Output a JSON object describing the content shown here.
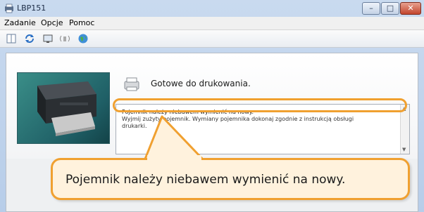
{
  "window": {
    "title": "LBP151",
    "controls": {
      "minimize": "–",
      "maximize": "□",
      "close": "✕"
    }
  },
  "menu": {
    "items": [
      "Zadanie",
      "Opcje",
      "Pomoc"
    ]
  },
  "toolbar": {
    "buttons": [
      "queue-icon",
      "refresh-icon",
      "monitor-icon",
      "network-icon",
      "globe-icon"
    ]
  },
  "status": {
    "text": "Gotowe do drukowania.",
    "message_lines": [
      "Pojemnik należy niebawem wymienić na nowy.",
      "Wyjmij zużyty pojemnik. Wymiany pojemnika dokonaj zgodnie z instrukcją obsługi",
      "drukarki."
    ]
  },
  "callout": {
    "text": "Pojemnik należy niebawem wymienić na nowy."
  },
  "colors": {
    "highlight": "#f0a030",
    "callout_bg": "#fff2dd",
    "title_bar": "#c9daef"
  }
}
